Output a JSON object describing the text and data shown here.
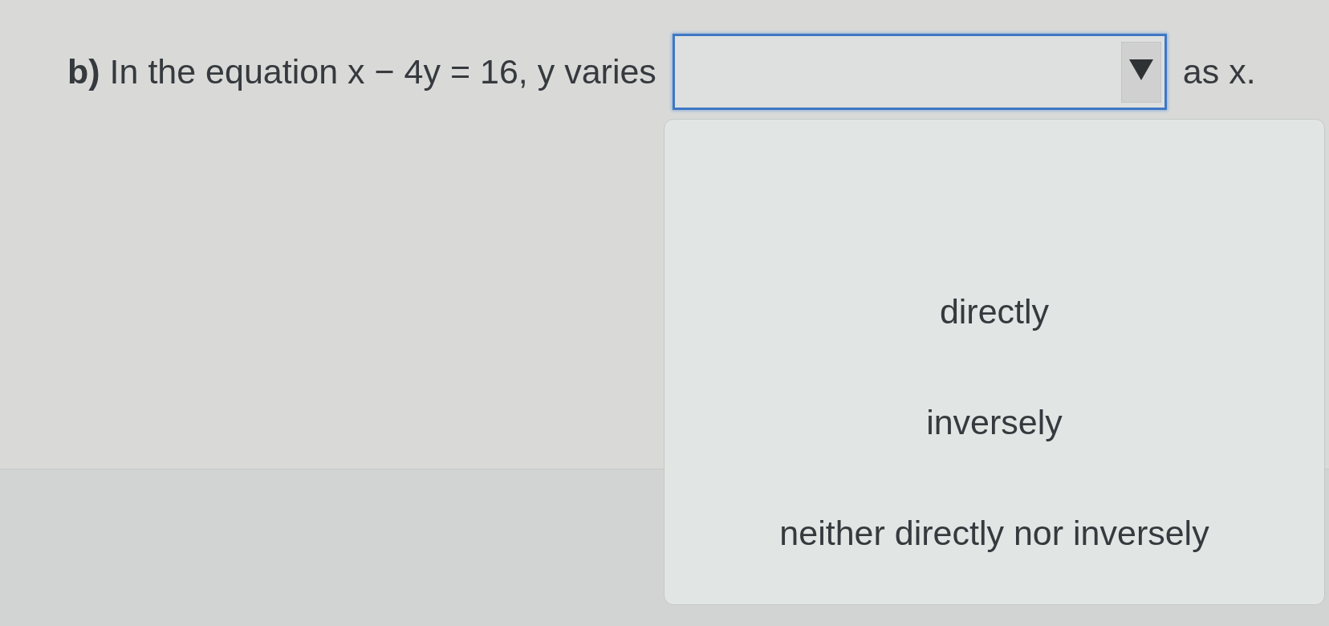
{
  "question": {
    "number": "b)",
    "text": "In the equation x − 4y = 16, y varies",
    "text_after": "as x."
  },
  "select": {
    "expanded": true
  },
  "options": [
    {
      "label": "directly",
      "selected": false
    },
    {
      "label": "inversely",
      "selected": false
    },
    {
      "label": "neither directly nor inversely",
      "selected": false
    }
  ]
}
